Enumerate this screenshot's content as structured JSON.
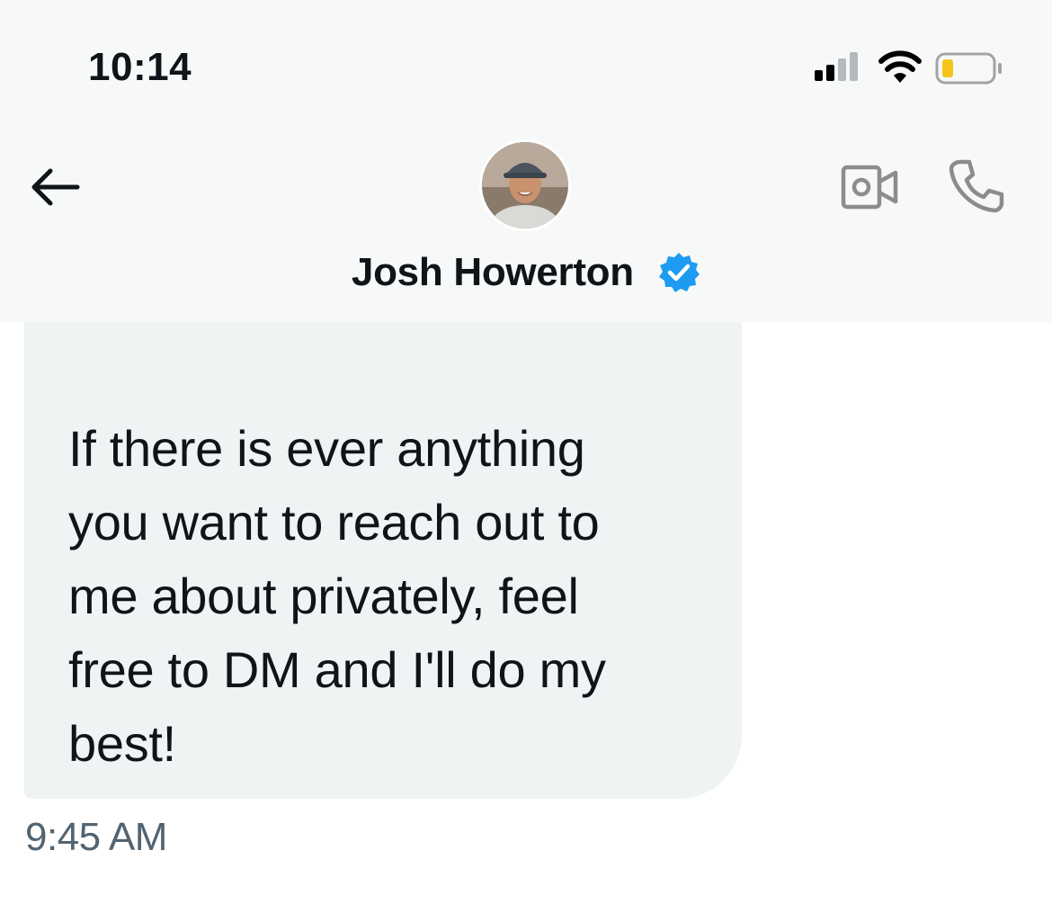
{
  "status_bar": {
    "time": "10:14"
  },
  "header": {
    "contact_name": "Josh Howerton",
    "verified": true,
    "icons": [
      "back-arrow-icon",
      "video-call-icon",
      "phone-call-icon",
      "verified-badge-icon"
    ]
  },
  "message": {
    "text": "If there is ever anything\nyou want to reach out to\nme about privately, feel\nfree to DM and I'll do my\nbest!",
    "timestamp": "9:45 AM"
  },
  "colors": {
    "bubble": "#eff3f4",
    "verified": "#1d9bf0",
    "timestamp": "#536471",
    "battery_fill": "#f5c518"
  }
}
